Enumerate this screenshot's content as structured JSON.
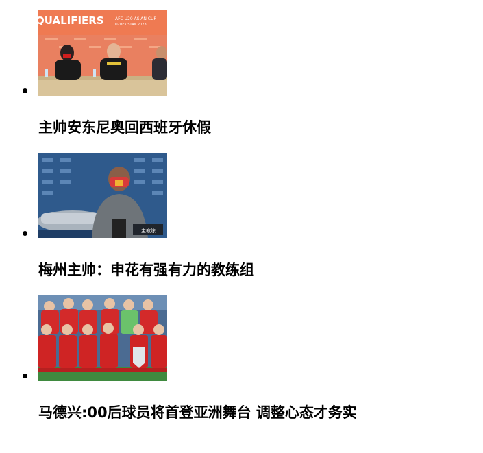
{
  "news": {
    "items": [
      {
        "headline": "主帅安东尼奥回西班牙休假",
        "thumb_caption": "QUALIFIERS",
        "thumb_sub1": "AFC U20 ASIAN CUP",
        "thumb_sub2": "UZBEKISTAN 2023"
      },
      {
        "headline": "梅州主帅：申花有强有力的教练组",
        "thumb_caption": "主教练"
      },
      {
        "headline": "马德兴:00后球员将首登亚洲舞台 调整心态才务实"
      }
    ]
  }
}
